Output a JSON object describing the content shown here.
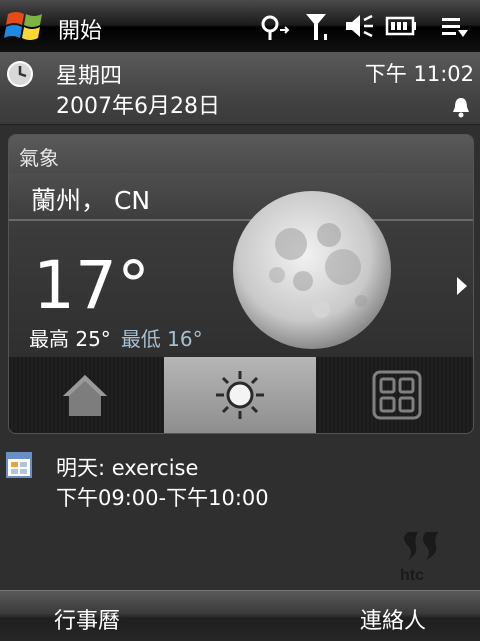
{
  "statusbar": {
    "start_label": "開始",
    "icons": [
      "start-flag-icon",
      "connectivity-icon",
      "signal-icon",
      "volume-icon",
      "battery-icon",
      "menu-icon"
    ]
  },
  "datetime": {
    "day": "星期四",
    "date": "2007年6月28日",
    "time": "下午 11:02"
  },
  "weather": {
    "title": "氣象",
    "city": "蘭州， CN",
    "temperature": "17°",
    "high_label": "最高 25°",
    "low_label": "最低 16°",
    "condition_icon": "moon",
    "tabs": [
      {
        "icon": "home-icon",
        "selected": false
      },
      {
        "icon": "sun-icon",
        "selected": true
      },
      {
        "icon": "grid-icon",
        "selected": false
      }
    ]
  },
  "appointment": {
    "title": "明天: exercise",
    "time": "下午09:00-下午10:00"
  },
  "softkeys": {
    "left": "行事曆",
    "right": "連絡人"
  }
}
